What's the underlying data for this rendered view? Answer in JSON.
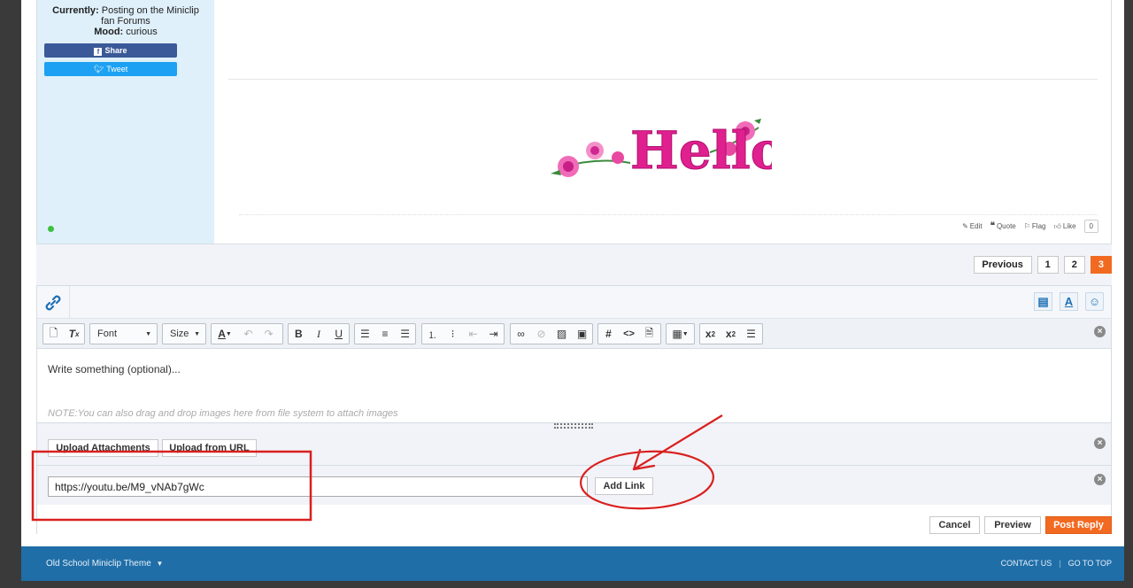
{
  "userpane": {
    "currently_label": "Currently:",
    "currently_value": "Posting on the Miniclip",
    "currently_value2": "fan Forums",
    "mood_label": "Mood:",
    "mood_value": "curious",
    "share_label": "Share",
    "tweet_label": "Tweet"
  },
  "post": {
    "signature_image_text": "Hello",
    "actions": {
      "edit": "Edit",
      "quote": "Quote",
      "flag": "Flag",
      "like": "Like",
      "like_count": "0"
    }
  },
  "pagination": {
    "previous": "Previous",
    "pages": [
      "1",
      "2",
      "3"
    ],
    "current": "3"
  },
  "toolbar": {
    "font_label": "Font",
    "size_label": "Size"
  },
  "editor": {
    "placeholder": "Write something (optional)...",
    "note": "NOTE:You can also drag and drop images here from file system to attach images",
    "upload_attachments": "Upload Attachments",
    "upload_from_url": "Upload from URL",
    "url_value": "https://youtu.be/M9_vNAb7gWc",
    "add_link": "Add Link",
    "cancel": "Cancel",
    "preview": "Preview",
    "post_reply": "Post Reply"
  },
  "footer": {
    "theme": "Old School Miniclip Theme",
    "theme_caret": "▼",
    "contact_us": "CONTACT US",
    "separator": "|",
    "go_to_top": "GO TO TOP"
  },
  "colors": {
    "accent_orange": "#f26a21",
    "footer_blue": "#1f6ea8",
    "userpane_bg": "#dff0fb",
    "annotation_red": "#d9201f"
  }
}
